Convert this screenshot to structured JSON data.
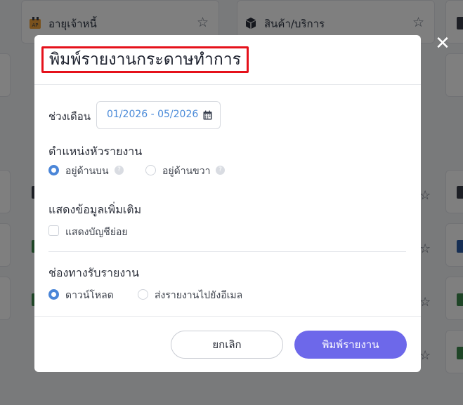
{
  "background": {
    "cards": [
      {
        "label": "อายุเจ้าหนี้",
        "icon": "ap-aging-icon",
        "icon_text": "AP"
      },
      {
        "label": "สินค้า/บริการ",
        "icon": "box-icon"
      }
    ]
  },
  "modal": {
    "title": "พิมพ์รายงานกระดาษทำการ",
    "period": {
      "label": "ช่วงเดือน",
      "value": "01/2026 - 05/2026",
      "icon": "calendar-icon"
    },
    "header_position": {
      "title": "ตำแหน่งหัวรายงาน",
      "options": [
        {
          "label": "อยู่ด้านบน",
          "selected": true
        },
        {
          "label": "อยู่ด้านขวา",
          "selected": false
        }
      ]
    },
    "extra_info": {
      "title": "แสดงข้อมูลเพิ่มเติม",
      "checkbox_label": "แสดงบัญชีย่อย",
      "checked": false
    },
    "delivery": {
      "title": "ช่องทางรับรายงาน",
      "options": [
        {
          "label": "ดาวน์โหลด",
          "selected": true
        },
        {
          "label": "ส่งรายงานไปยังอีเมล",
          "selected": false
        }
      ]
    },
    "buttons": {
      "cancel": "ยกเลิก",
      "print": "พิมพ์รายงาน"
    }
  },
  "colors": {
    "accent": "#6d68ea",
    "radio_on": "#4b86d8",
    "date_text": "#4b8bd9",
    "title_highlight": "#e5111b"
  }
}
